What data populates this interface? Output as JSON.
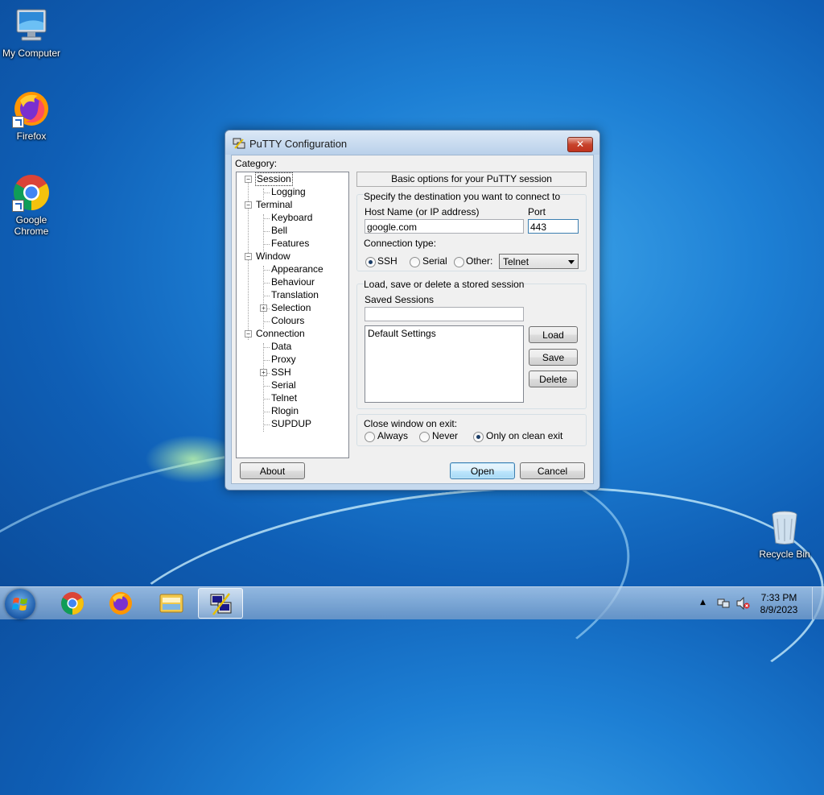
{
  "desktop": {
    "icons": [
      {
        "label": "My Computer",
        "icon": "computer-icon"
      },
      {
        "label": "Firefox",
        "icon": "firefox-icon"
      },
      {
        "label": "Google Chrome",
        "icon": "chrome-icon"
      },
      {
        "label": "Recycle Bin",
        "icon": "recycle-bin-icon"
      }
    ]
  },
  "window": {
    "title": "PuTTY Configuration",
    "close_glyph": "✕",
    "category_label": "Category:",
    "tree": [
      {
        "label": "Session",
        "level": 0,
        "expand": "−",
        "selected": true
      },
      {
        "label": "Logging",
        "level": 1
      },
      {
        "label": "Terminal",
        "level": 0,
        "expand": "−"
      },
      {
        "label": "Keyboard",
        "level": 1
      },
      {
        "label": "Bell",
        "level": 1
      },
      {
        "label": "Features",
        "level": 1
      },
      {
        "label": "Window",
        "level": 0,
        "expand": "−"
      },
      {
        "label": "Appearance",
        "level": 1
      },
      {
        "label": "Behaviour",
        "level": 1
      },
      {
        "label": "Translation",
        "level": 1
      },
      {
        "label": "Selection",
        "level": 1,
        "expand": "+"
      },
      {
        "label": "Colours",
        "level": 1
      },
      {
        "label": "Connection",
        "level": 0,
        "expand": "−"
      },
      {
        "label": "Data",
        "level": 1
      },
      {
        "label": "Proxy",
        "level": 1
      },
      {
        "label": "SSH",
        "level": 1,
        "expand": "+"
      },
      {
        "label": "Serial",
        "level": 1
      },
      {
        "label": "Telnet",
        "level": 1
      },
      {
        "label": "Rlogin",
        "level": 1
      },
      {
        "label": "SUPDUP",
        "level": 1
      }
    ],
    "panel_header": "Basic options for your PuTTY session",
    "destination": {
      "heading": "Specify the destination you want to connect to",
      "host_label": "Host Name (or IP address)",
      "host_value": "google.com",
      "port_label": "Port",
      "port_value": "443",
      "conn_type_label": "Connection type:",
      "radios": [
        "SSH",
        "Serial",
        "Other:"
      ],
      "selected": "SSH",
      "other_select": "Telnet"
    },
    "sessions": {
      "heading": "Load, save or delete a stored session",
      "saved_label": "Saved Sessions",
      "saved_value": "",
      "list": [
        "Default Settings"
      ],
      "load": "Load",
      "save": "Save",
      "delete": "Delete"
    },
    "close_exit": {
      "label": "Close window on exit:",
      "options": [
        "Always",
        "Never",
        "Only on clean exit"
      ],
      "selected": "Only on clean exit"
    },
    "buttons": {
      "about": "About",
      "open": "Open",
      "cancel": "Cancel"
    }
  },
  "taskbar": {
    "apps": [
      "chrome-icon",
      "firefox-icon",
      "explorer-icon",
      "putty-icon"
    ],
    "active": "putty-icon",
    "time": "7:33 PM",
    "date": "8/9/2023"
  }
}
